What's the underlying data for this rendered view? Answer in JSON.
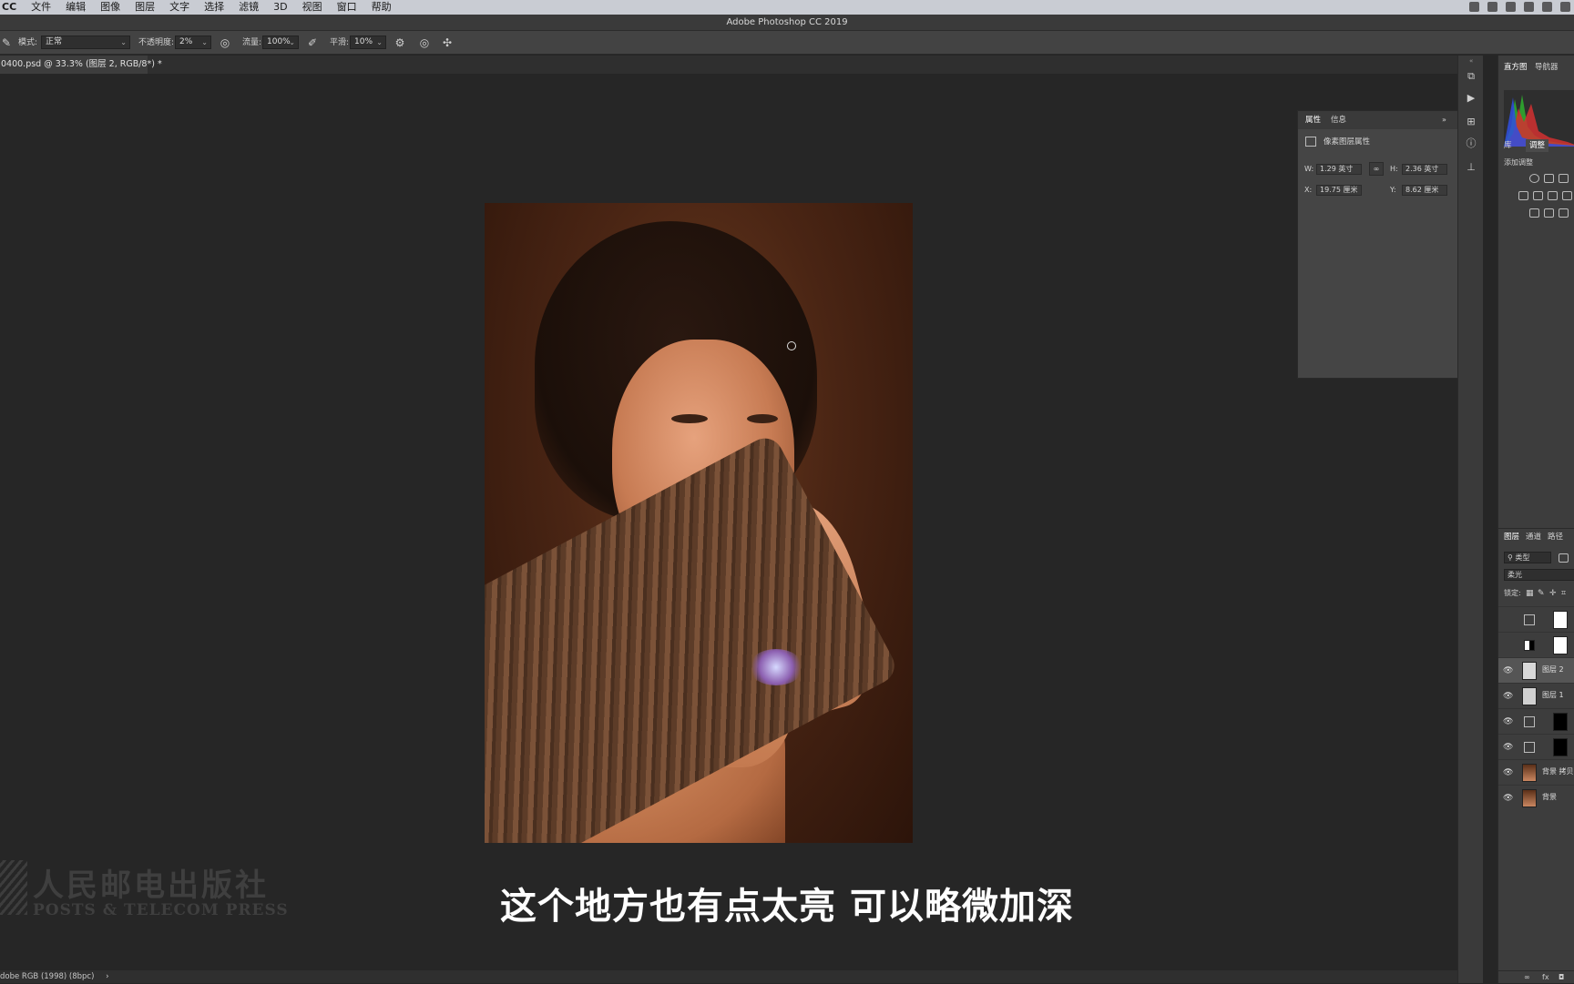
{
  "menubar": {
    "app": "CC",
    "items": [
      "文件",
      "编辑",
      "图像",
      "图层",
      "文字",
      "选择",
      "滤镜",
      "3D",
      "视图",
      "窗口",
      "帮助"
    ]
  },
  "window_title": "Adobe Photoshop CC 2019",
  "options_bar": {
    "mode_label": "模式:",
    "mode_value": "正常",
    "opacity_label": "不透明度:",
    "opacity_value": "2%",
    "flow_label": "流量:",
    "flow_value": "100%",
    "smoothing_label": "平滑:",
    "smoothing_value": "10%"
  },
  "document_tab": "0400.psd @ 33.3% (图层 2, RGB/8*) *",
  "subtitle": "这个地方也有点太亮 可以略微加深",
  "watermark": {
    "cn": "人民邮电出版社",
    "en": "POSTS & TELECOM PRESS"
  },
  "status_bar": "dobe RGB (1998) (8bpc)",
  "properties_panel": {
    "tabs": [
      "属性",
      "信息"
    ],
    "header": "像素图层属性",
    "w_label": "W:",
    "w_value": "1.29 英寸",
    "h_label": "H:",
    "h_value": "2.36 英寸",
    "x_label": "X:",
    "x_value": "19.75 厘米",
    "y_label": "Y:",
    "y_value": "8.62 厘米"
  },
  "right_panels": {
    "top_tabs": [
      "直方图",
      "导航器"
    ],
    "mid_tabs": [
      "库",
      "调整"
    ],
    "add_adjustment": "添加调整",
    "layer_tabs": [
      "图层",
      "通道",
      "路径"
    ],
    "filter_kind": "类型",
    "blend_mode": "柔光",
    "lock_label": "锁定:",
    "layers": [
      {
        "name": "",
        "visible": false,
        "kind": "adjustment-white"
      },
      {
        "name": "",
        "visible": false,
        "kind": "adjustment-white"
      },
      {
        "name": "图层 2",
        "visible": true,
        "kind": "pixel",
        "selected": true
      },
      {
        "name": "图层 1",
        "visible": true,
        "kind": "pixel"
      },
      {
        "name": "",
        "visible": true,
        "kind": "adjustment-black"
      },
      {
        "name": "",
        "visible": true,
        "kind": "adjustment-black"
      },
      {
        "name": "背景 拷贝",
        "visible": true,
        "kind": "photo"
      },
      {
        "name": "背景",
        "visible": true,
        "kind": "photo"
      }
    ]
  }
}
